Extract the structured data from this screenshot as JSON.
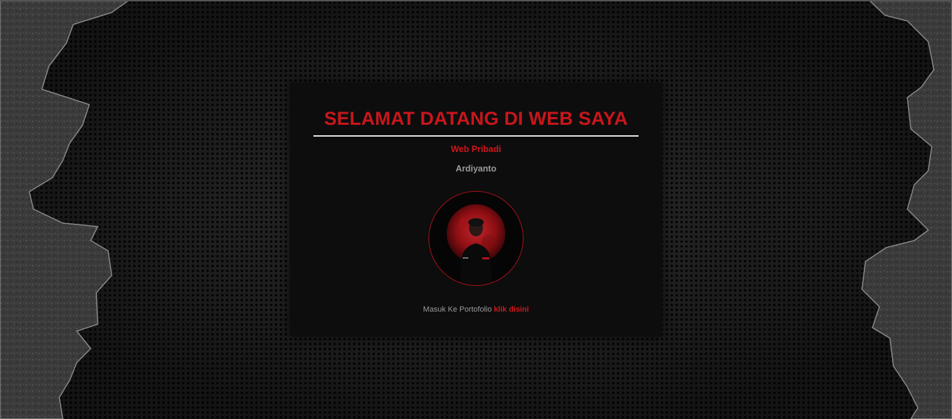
{
  "page": {
    "title": "SELAMAT DATANG DI WEB SAYA",
    "subtitle": "Web Pribadi",
    "name": "Ardiyanto",
    "cta_text": "Masuk Ke Portofolio",
    "cta_link": "klik disini"
  },
  "colors": {
    "accent": "#c8161b",
    "card": "#0d0d0d",
    "muted": "#9b9b9b"
  },
  "icons": {
    "avatar": "profile-photo-blood-moon"
  }
}
